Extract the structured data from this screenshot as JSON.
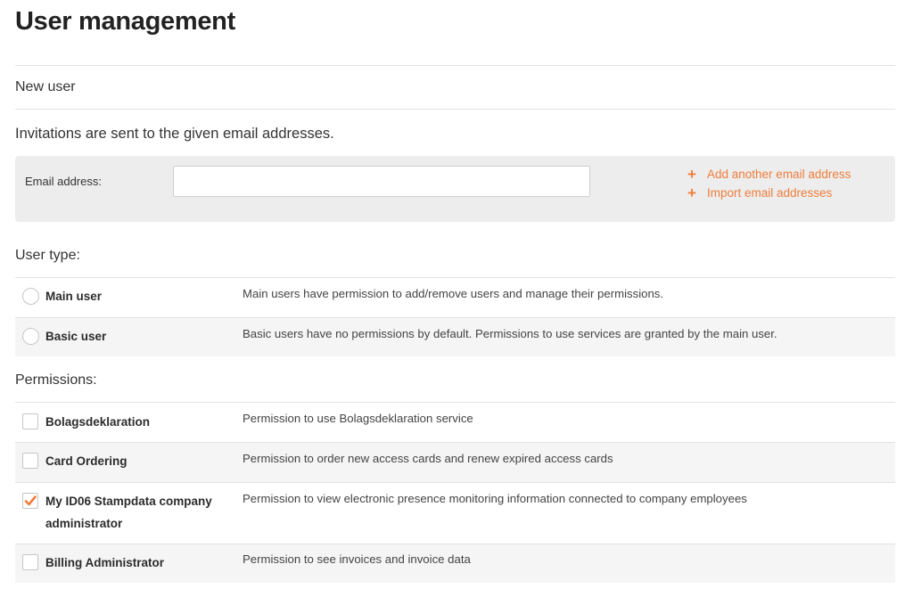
{
  "page": {
    "title": "User management",
    "new_user_label": "New user",
    "invite_text": "Invitations are sent to the given email addresses."
  },
  "email": {
    "label": "Email address:",
    "value": "",
    "placeholder": "",
    "add_another_label": "Add another email address",
    "import_label": "Import email addresses"
  },
  "user_type": {
    "heading": "User type:",
    "options": [
      {
        "name": "Main user",
        "description": "Main users have permission to add/remove users and manage their permissions.",
        "selected": false
      },
      {
        "name": "Basic user",
        "description": "Basic users have no permissions by default. Permissions to use services are granted by the main user.",
        "selected": false
      }
    ]
  },
  "permissions": {
    "heading": "Permissions:",
    "items": [
      {
        "name": "Bolagsdeklaration",
        "description": "Permission to use Bolagsdeklaration service",
        "checked": false
      },
      {
        "name": "Card Ordering",
        "description": "Permission to order new access cards and renew expired access cards",
        "checked": false
      },
      {
        "name_line1": "My ID06 Stampdata company",
        "name_line2": "administrator",
        "description": "Permission to view electronic presence monitoring information connected to company employees",
        "checked": true
      },
      {
        "name": "Billing Administrator",
        "description": "Permission to see invoices and invoice data",
        "checked": false
      }
    ]
  },
  "colors": {
    "accent": "#ee7d3b",
    "panel_bg": "#ededed",
    "row_alt_bg": "#f5f5f5",
    "divider": "#e2e2e2"
  },
  "icons": {
    "add": "plus-icon",
    "import": "plus-icon",
    "check": "checkmark-icon"
  }
}
